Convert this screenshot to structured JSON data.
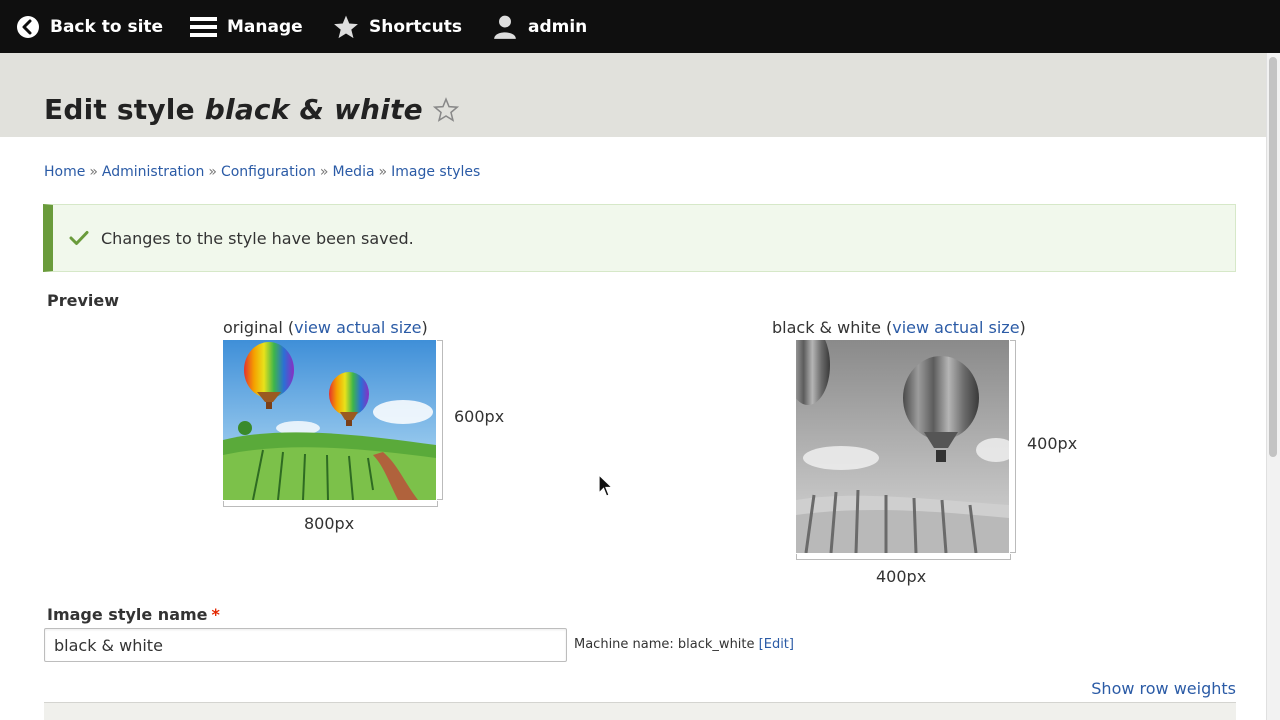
{
  "toolbar": {
    "back_label": "Back to site",
    "manage_label": "Manage",
    "shortcuts_label": "Shortcuts",
    "user_label": "admin"
  },
  "header": {
    "title_prefix": "Edit style",
    "style_name": "black & white"
  },
  "breadcrumb": {
    "items": [
      "Home",
      "Administration",
      "Configuration",
      "Media",
      "Image styles"
    ],
    "separator": "»"
  },
  "message": {
    "text": "Changes to the style have been saved.",
    "color": "#6a9b3b"
  },
  "preview": {
    "label": "Preview",
    "original": {
      "caption": "original",
      "link_label": "view actual size",
      "height_label": "600px",
      "width_label": "800px"
    },
    "derivative": {
      "caption": "black & white",
      "link_label": "view actual size",
      "height_label": "400px",
      "width_label": "400px"
    }
  },
  "form": {
    "name_label": "Image style name",
    "required_mark": "*",
    "name_value": "black & white",
    "machine_name_label": "Machine name: black_white",
    "machine_edit_label": "[Edit]",
    "show_row_weights_label": "Show row weights"
  },
  "colors": {
    "toolbar_bg": "#0f0f0f",
    "header_bg": "#e1e1dc",
    "link": "#2b5ba6",
    "status_ok": "#6a9b3b",
    "required": "#e32700"
  },
  "icons": [
    "back-arrow-icon",
    "hamburger-icon",
    "star-icon",
    "user-icon",
    "star-outline-icon",
    "checkmark-icon",
    "mouse-cursor-icon"
  ]
}
